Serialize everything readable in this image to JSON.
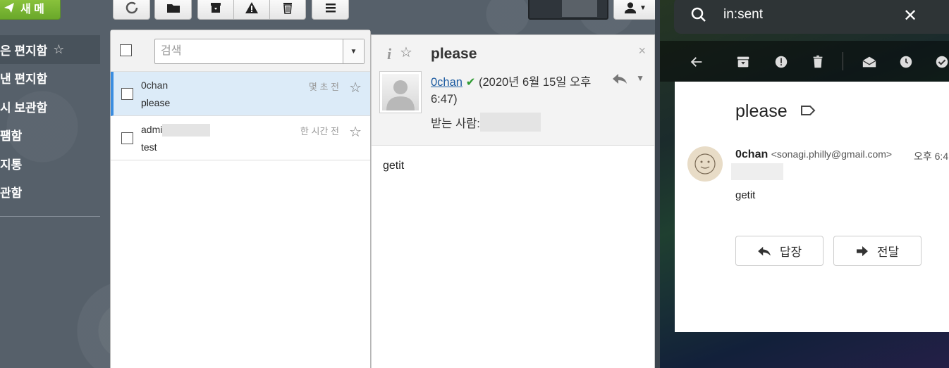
{
  "left": {
    "compose_label": "새 메",
    "folders": [
      {
        "label": "받은 편지함",
        "display": "은 편지함"
      },
      {
        "label": "보낸 편지함",
        "display": "낸 편지함"
      },
      {
        "label": "임시 보관함",
        "display": "시 보관함"
      },
      {
        "label": "스팸함",
        "display": "팸함"
      },
      {
        "label": "휴지통",
        "display": "지통"
      },
      {
        "label": "보관함",
        "display": "관함"
      }
    ],
    "search_placeholder": "검색",
    "messages": [
      {
        "from": "0chan",
        "subject": "please",
        "date": "몇 초 전"
      },
      {
        "from": "admi",
        "subject": "test",
        "date": "한 시간 전"
      }
    ],
    "reader": {
      "subject": "please",
      "sender_name": "0chan",
      "sender_date": "(2020년 6월 15일 오후 6:47)",
      "to_label": "받는 사람:",
      "body": "getit",
      "close": "×"
    }
  },
  "right": {
    "search_query": "in:sent",
    "subject": "please",
    "sender_name": "0chan",
    "sender_email": "<sonagi.philly@gmail.com>",
    "time": "오후 6:4",
    "body": "getit",
    "reply_label": "답장",
    "forward_label": "전달"
  },
  "colors": {
    "compose_green": "#7ab833",
    "selected_row": "#dcebf8",
    "selected_accent": "#3a8de0",
    "link_blue": "#1b5aa0",
    "verified_green": "#2e9b31"
  }
}
